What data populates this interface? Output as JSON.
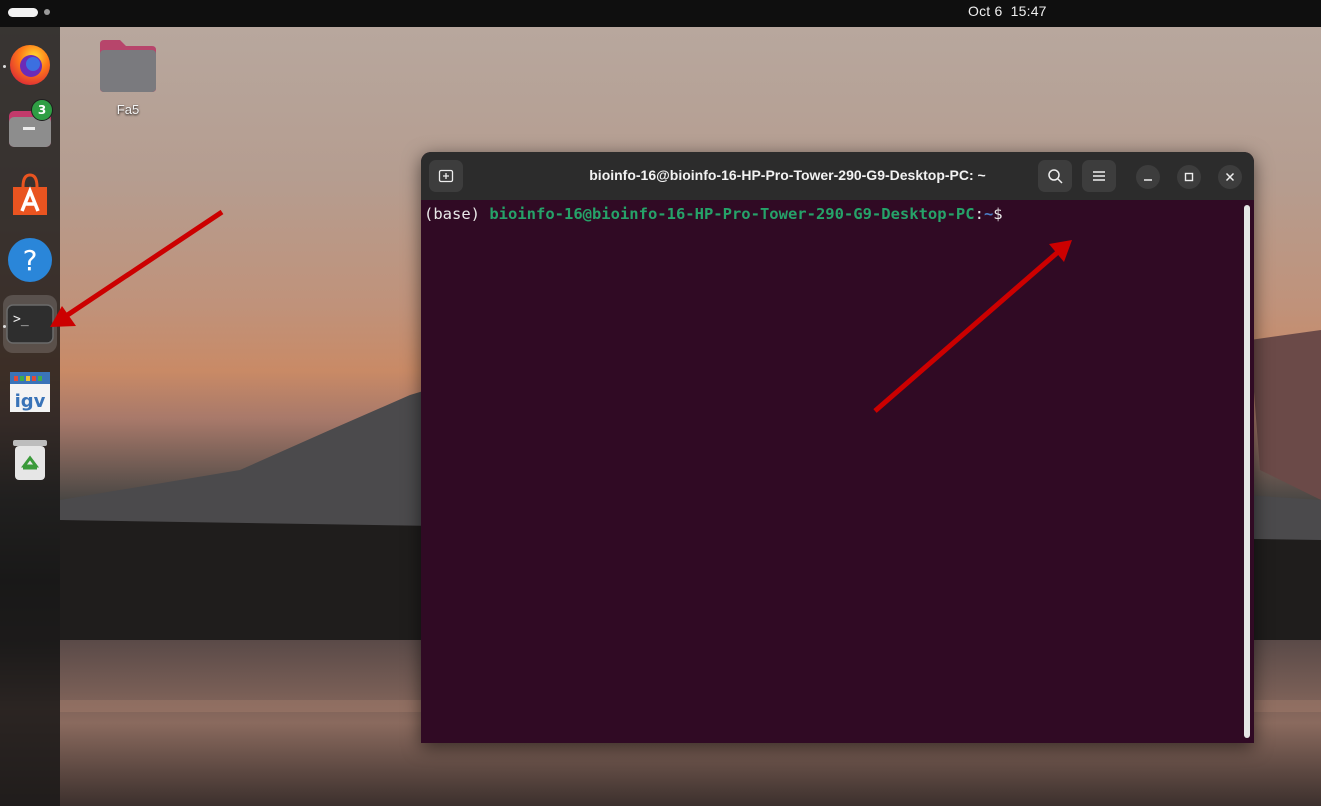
{
  "topbar": {
    "clock": "Oct 6  15:47"
  },
  "dock": {
    "items": [
      {
        "name": "firefox",
        "icon": "firefox-icon"
      },
      {
        "name": "files",
        "icon": "files-icon",
        "badge": "3"
      },
      {
        "name": "app-center",
        "icon": "app-center-icon"
      },
      {
        "name": "help",
        "icon": "help-icon",
        "glyph": "?"
      },
      {
        "name": "terminal",
        "icon": "terminal-icon",
        "glyph": ">_"
      },
      {
        "name": "igv",
        "icon": "igv-icon",
        "glyph": "igv"
      },
      {
        "name": "trash",
        "icon": "trash-icon"
      }
    ]
  },
  "desktop": {
    "folder_label": "Fa5"
  },
  "terminal": {
    "title": "bioinfo-16@bioinfo-16-HP-Pro-Tower-290-G9-Desktop-PC: ~",
    "prompt_env": "(base) ",
    "prompt_user": "bioinfo-16@bioinfo-16-HP-Pro-Tower-290-G9-Desktop-PC",
    "prompt_sep": ":",
    "prompt_path": "~",
    "prompt_symbol": "$"
  },
  "colors": {
    "terminal_bg": "#300a24",
    "prompt_user": "#26a269",
    "prompt_path": "#4a7ec7",
    "annotation_arrow": "#cc0000",
    "badge": "#2f9e44"
  }
}
